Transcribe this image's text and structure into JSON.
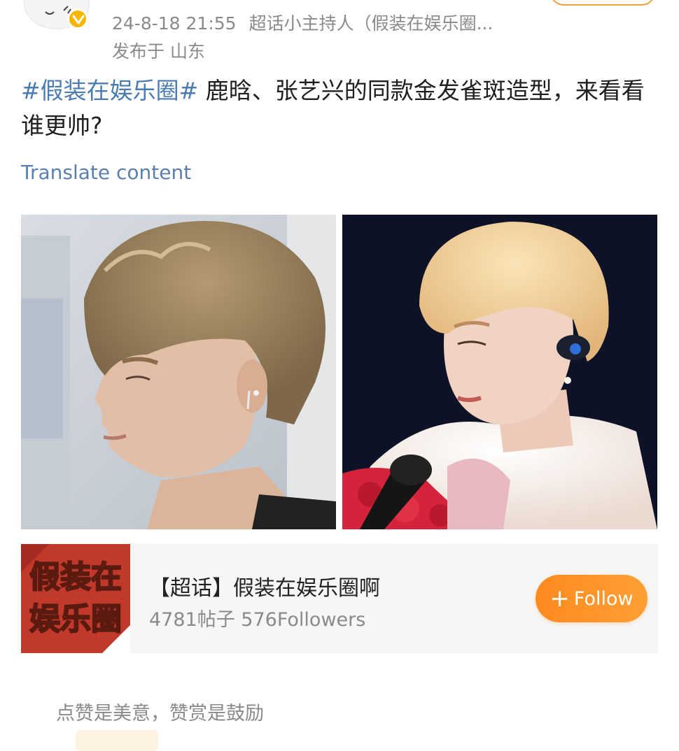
{
  "post": {
    "timestamp": "24-8-18 21:55",
    "source": "超话小主持人（假装在娱乐圈...",
    "location": "发布于 山东",
    "hashtag": "#假装在娱乐圈#",
    "body": " 鹿晗、张艺兴的同款金发雀斑造型，来看看谁更帅?",
    "translate_label": "Translate content"
  },
  "topic_card": {
    "logo_text_line1": "假装在",
    "logo_text_line2": "娱乐圈",
    "title": "【超话】假装在娱乐圈啊",
    "stats": "4781帖子 576Followers",
    "follow_label": "Follow",
    "follow_icon": "plus-icon"
  },
  "reward": {
    "text": "点赞是美意，赞赏是鼓励"
  },
  "colors": {
    "hashtag": "#4a7bb1",
    "follow_button": "#ff8f24",
    "meta_text": "#8a8a8a",
    "verified_badge": "#f7b500"
  },
  "icons": {
    "verified": "verified-v-icon"
  }
}
